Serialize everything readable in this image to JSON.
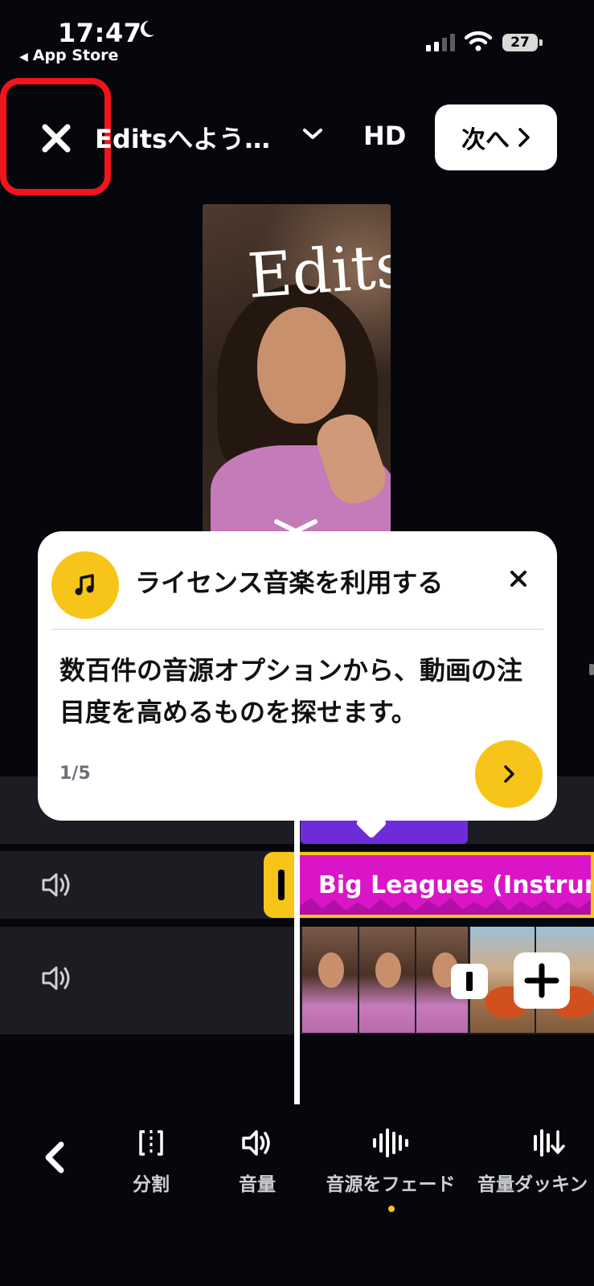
{
  "status_bar": {
    "time": "17:47",
    "back_to_app": "App Store",
    "battery": "27"
  },
  "header": {
    "project_title": "Editsへよう…",
    "quality": "HD",
    "next_label": "次へ"
  },
  "preview": {
    "overlay_text": "Edits"
  },
  "timeline": {
    "music_clip_label": "Big Leagues (Instrum"
  },
  "tooltip": {
    "title": "ライセンス音楽を利用する",
    "body": "数百件の音源オプションから、動画の注目度を高めるものを探せます。",
    "step": "1/5"
  },
  "toolbar": {
    "items": [
      {
        "label": "分割",
        "icon": "split-icon"
      },
      {
        "label": "音量",
        "icon": "volume-icon"
      },
      {
        "label": "音源をフェード",
        "icon": "fade-icon"
      },
      {
        "label": "音量ダッキン",
        "icon": "ducking-icon"
      }
    ]
  },
  "colors": {
    "accent_yellow": "#f7c51a",
    "music_clip": "#d915c7",
    "purple_clip": "#6e2bd9",
    "highlight_red": "#f0141e",
    "background": "#06070c"
  }
}
